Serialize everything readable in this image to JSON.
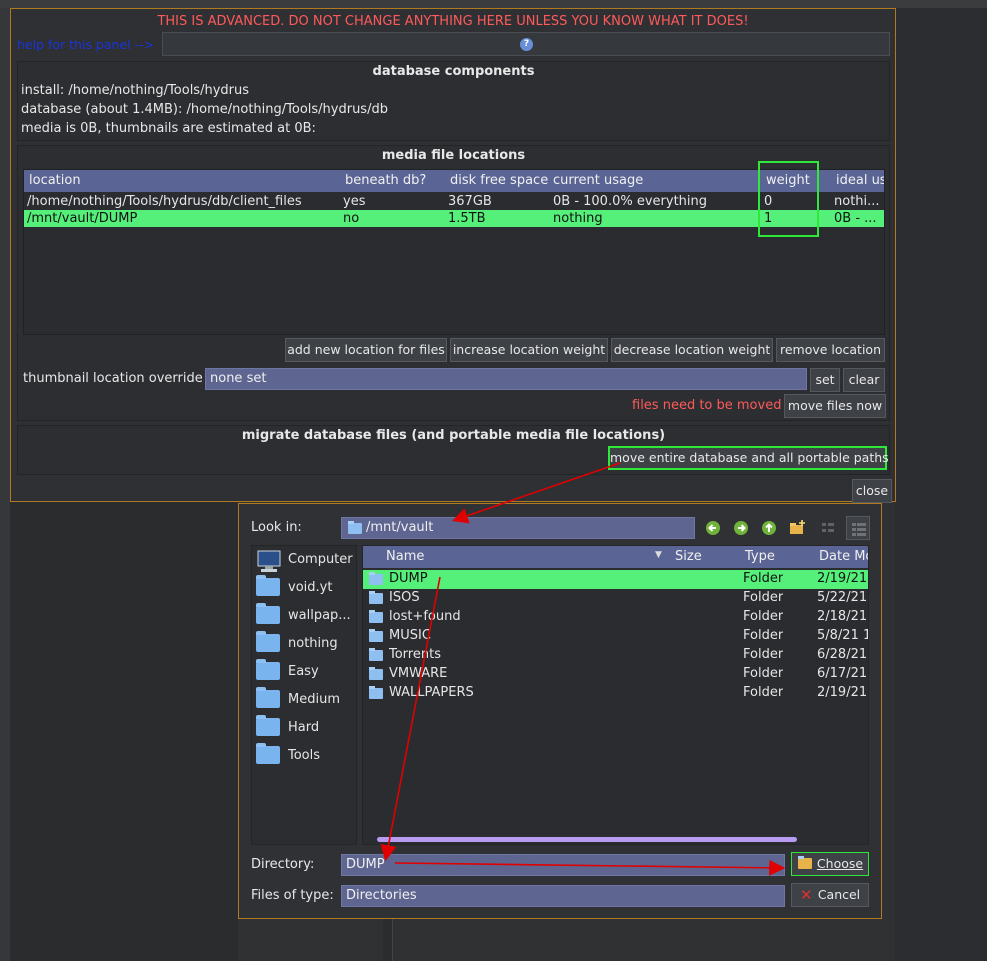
{
  "warning": "THIS IS ADVANCED. DO NOT CHANGE ANYTHING HERE UNLESS YOU KNOW WHAT IT DOES!",
  "help_label": "help for this panel -->",
  "help_icon": "question-icon",
  "db_components": {
    "title": "database components",
    "install": "install: /home/nothing/Tools/hydrus",
    "database": "database (about 1.4MB): /home/nothing/Tools/hydrus/db",
    "media": "media is 0B, thumbnails are estimated at 0B:"
  },
  "media_locations": {
    "title": "media file locations",
    "columns": [
      "location",
      "beneath db?",
      "disk free space",
      "current usage",
      "weight",
      "ideal us"
    ],
    "rows": [
      {
        "location": "/home/nothing/Tools/hydrus/db/client_files",
        "beneath": "yes",
        "free": "367GB",
        "usage": "0B - 100.0% everything",
        "weight": "0",
        "ideal": "nothi..."
      },
      {
        "location": "/mnt/vault/DUMP",
        "beneath": "no",
        "free": "1.5TB",
        "usage": "nothing",
        "weight": "1",
        "ideal": "0B - ..."
      }
    ],
    "buttons": {
      "add": "add new location for files",
      "increase": "increase location weight",
      "decrease": "decrease location weight",
      "remove": "remove location"
    },
    "thumb_label": "thumbnail location override",
    "thumb_value": "none set",
    "set": "set",
    "clear": "clear",
    "status": "files need to be moved",
    "move_now": "move files now"
  },
  "migrate": {
    "title": "migrate database files (and portable media file locations)",
    "button": "move entire database and all portable paths"
  },
  "close": "close",
  "file_dialog": {
    "look_in_label": "Look in:",
    "look_in_value": "/mnt/vault",
    "sidebar": [
      "Computer",
      "void.yt",
      "wallpap...",
      "nothing",
      "Easy",
      "Medium",
      "Hard",
      "Tools"
    ],
    "columns": [
      "Name",
      "Size",
      "Type",
      "Date Mo"
    ],
    "files": [
      {
        "name": "DUMP",
        "type": "Folder",
        "date": "2/19/21"
      },
      {
        "name": "ISOS",
        "type": "Folder",
        "date": "5/22/21"
      },
      {
        "name": "lost+found",
        "type": "Folder",
        "date": "2/18/21"
      },
      {
        "name": "MUSIC",
        "type": "Folder",
        "date": "5/8/21 1"
      },
      {
        "name": "Torrents",
        "type": "Folder",
        "date": "6/28/21"
      },
      {
        "name": "VMWARE",
        "type": "Folder",
        "date": "6/17/21"
      },
      {
        "name": "WALLPAPERS",
        "type": "Folder",
        "date": "2/19/21"
      }
    ],
    "directory_label": "Directory:",
    "directory_value": "DUMP",
    "choose": "Choose",
    "types_label": "Files of type:",
    "types_value": "Directories",
    "cancel": "Cancel"
  },
  "colors": {
    "accent": "#55f07a",
    "highlight_box": "#2ee83a",
    "warning": "#ff5a5a",
    "annotation": "#e00000"
  }
}
